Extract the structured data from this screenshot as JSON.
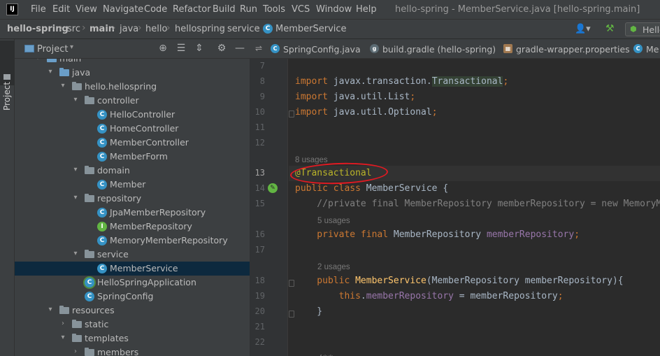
{
  "app": {
    "logo": "IJ",
    "window_title": "hello-spring - MemberService.java [hello-spring.main]"
  },
  "menu": [
    "File",
    "Edit",
    "View",
    "Navigate",
    "Code",
    "Refactor",
    "Build",
    "Run",
    "Tools",
    "VCS",
    "Window",
    "Help"
  ],
  "breadcrumb": [
    "hello-spring",
    "src",
    "main",
    "java",
    "hello",
    "hellospring",
    "service",
    "MemberService"
  ],
  "toolbar": {
    "run_config": "Hello"
  },
  "project_panel": {
    "title": "Project",
    "stripe_label": "Project",
    "tree": [
      {
        "label": "main",
        "kind": "folder-blue",
        "level": 2,
        "open": true
      },
      {
        "label": "java",
        "kind": "folder-blue",
        "level": 3,
        "open": true
      },
      {
        "label": "hello.hellospring",
        "kind": "folder",
        "level": 4,
        "open": true
      },
      {
        "label": "controller",
        "kind": "folder",
        "level": 5,
        "open": true
      },
      {
        "label": "HelloController",
        "kind": "class",
        "level": 6
      },
      {
        "label": "HomeController",
        "kind": "class",
        "level": 6
      },
      {
        "label": "MemberController",
        "kind": "class",
        "level": 6
      },
      {
        "label": "MemberForm",
        "kind": "class",
        "level": 6
      },
      {
        "label": "domain",
        "kind": "folder",
        "level": 5,
        "open": true
      },
      {
        "label": "Member",
        "kind": "class",
        "level": 6
      },
      {
        "label": "repository",
        "kind": "folder",
        "level": 5,
        "open": true
      },
      {
        "label": "JpaMemberRepository",
        "kind": "class",
        "level": 6
      },
      {
        "label": "MemberRepository",
        "kind": "interface",
        "level": 6
      },
      {
        "label": "MemoryMemberRepository",
        "kind": "class",
        "level": 6
      },
      {
        "label": "service",
        "kind": "folder",
        "level": 5,
        "open": true
      },
      {
        "label": "MemberService",
        "kind": "class",
        "level": 6,
        "selected": true
      },
      {
        "label": "HelloSpringApplication",
        "kind": "app",
        "level": 5
      },
      {
        "label": "SpringConfig",
        "kind": "class",
        "level": 5
      },
      {
        "label": "resources",
        "kind": "folder",
        "level": 3,
        "open": true
      },
      {
        "label": "static",
        "kind": "folder",
        "level": 4,
        "open": false
      },
      {
        "label": "templates",
        "kind": "folder",
        "level": 4,
        "open": true
      },
      {
        "label": "members",
        "kind": "folder",
        "level": 5,
        "open": false
      }
    ]
  },
  "editor_tabs": [
    {
      "label": "SpringConfig.java",
      "icon": "class-icon"
    },
    {
      "label": "build.gradle (hello-spring)",
      "icon": "gradle-icon"
    },
    {
      "label": "gradle-wrapper.properties",
      "icon": "properties-icon"
    },
    {
      "label": "Me",
      "icon": "class-icon"
    }
  ],
  "editor": {
    "lines": [
      {
        "num": "7",
        "type": "code",
        "segments": []
      },
      {
        "num": "8",
        "type": "code",
        "segments": [
          {
            "t": "import ",
            "c": "kw"
          },
          {
            "t": "javax.transaction.",
            "c": ""
          },
          {
            "t": "Transactional",
            "c": "hl"
          },
          {
            "t": ";",
            "c": "kw"
          }
        ]
      },
      {
        "num": "9",
        "type": "code",
        "segments": [
          {
            "t": "import ",
            "c": "kw"
          },
          {
            "t": "java.util.List",
            "c": ""
          },
          {
            "t": ";",
            "c": "kw"
          }
        ]
      },
      {
        "num": "10",
        "type": "code",
        "segments": [
          {
            "t": "import ",
            "c": "kw"
          },
          {
            "t": "java.util.Optional",
            "c": ""
          },
          {
            "t": ";",
            "c": "kw"
          }
        ]
      },
      {
        "num": "11",
        "type": "code",
        "segments": []
      },
      {
        "num": "12",
        "type": "code",
        "segments": []
      },
      {
        "num": "",
        "type": "hint",
        "text": "8 usages",
        "indent": 0
      },
      {
        "num": "13",
        "type": "code",
        "current": true,
        "segments": [
          {
            "t": "@Transactional",
            "c": "an"
          }
        ]
      },
      {
        "num": "14",
        "type": "code",
        "segments": [
          {
            "t": "public class ",
            "c": "kw"
          },
          {
            "t": "MemberService {",
            "c": ""
          }
        ]
      },
      {
        "num": "15",
        "type": "code",
        "segments": [
          {
            "t": "    //private final MemberRepository memberRepository = new MemoryMemberRepository();",
            "c": "cm"
          }
        ]
      },
      {
        "num": "",
        "type": "hint",
        "text": "5 usages",
        "indent": 4
      },
      {
        "num": "16",
        "type": "code",
        "segments": [
          {
            "t": "    private final ",
            "c": "kw"
          },
          {
            "t": "MemberRepository ",
            "c": ""
          },
          {
            "t": "memberRepository",
            "c": "fd"
          },
          {
            "t": ";",
            "c": "kw"
          }
        ]
      },
      {
        "num": "17",
        "type": "code",
        "segments": []
      },
      {
        "num": "",
        "type": "hint",
        "text": "2 usages",
        "indent": 4
      },
      {
        "num": "18",
        "type": "code",
        "segments": [
          {
            "t": "    public ",
            "c": "kw"
          },
          {
            "t": "MemberService",
            "c": "fn"
          },
          {
            "t": "(MemberRepository memberRepository){",
            "c": ""
          }
        ]
      },
      {
        "num": "19",
        "type": "code",
        "segments": [
          {
            "t": "        this",
            "c": "kw"
          },
          {
            "t": ".",
            "c": ""
          },
          {
            "t": "memberRepository",
            "c": "fd"
          },
          {
            "t": " = memberRepository",
            "c": ""
          },
          {
            "t": ";",
            "c": "kw"
          }
        ]
      },
      {
        "num": "20",
        "type": "code",
        "segments": [
          {
            "t": "    }",
            "c": ""
          }
        ]
      },
      {
        "num": "21",
        "type": "code",
        "segments": []
      },
      {
        "num": "22",
        "type": "code",
        "segments": []
      },
      {
        "num": "",
        "type": "code",
        "segments": [
          {
            "t": "    /**",
            "c": "cm"
          }
        ]
      }
    ]
  },
  "annotation": {
    "color": "#e11a22"
  }
}
